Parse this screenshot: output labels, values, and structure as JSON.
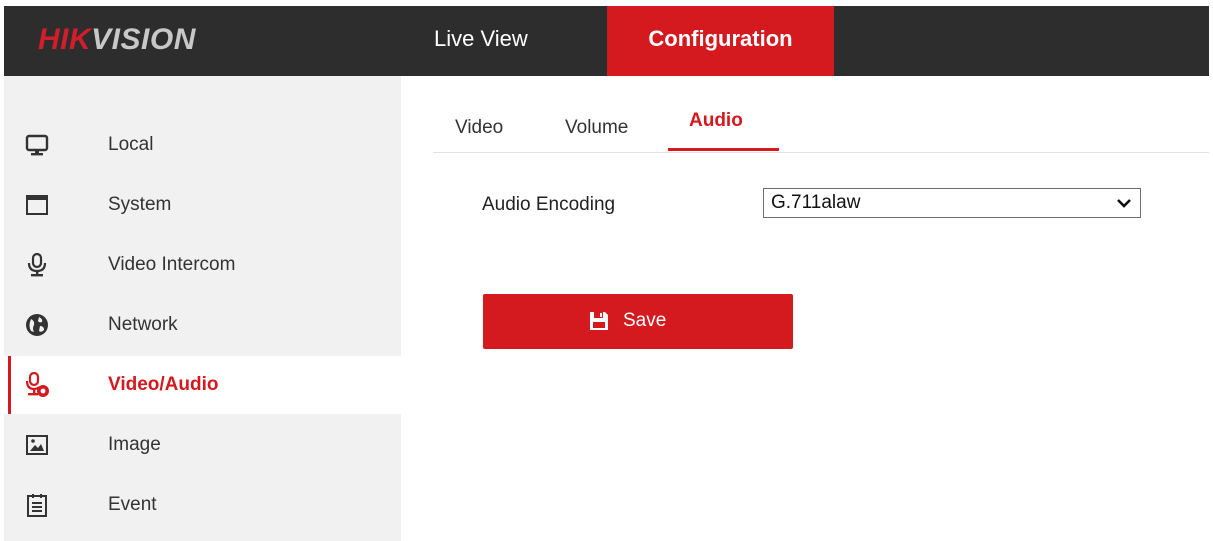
{
  "brand": {
    "prefix": "HIK",
    "suffix": "VISION"
  },
  "topnav": {
    "items": [
      {
        "label": "Live View",
        "active": false
      },
      {
        "label": "Configuration",
        "active": true
      }
    ]
  },
  "sidebar": {
    "items": [
      {
        "label": "Local",
        "icon": "monitor-icon",
        "active": false
      },
      {
        "label": "System",
        "icon": "window-icon",
        "active": false
      },
      {
        "label": "Video Intercom",
        "icon": "microphone-icon",
        "active": false
      },
      {
        "label": "Network",
        "icon": "globe-icon",
        "active": false
      },
      {
        "label": "Video/Audio",
        "icon": "microphone-camera-icon",
        "active": true
      },
      {
        "label": "Image",
        "icon": "image-icon",
        "active": false
      },
      {
        "label": "Event",
        "icon": "calendar-icon",
        "active": false
      }
    ]
  },
  "tabs": {
    "items": [
      {
        "label": "Video",
        "active": false
      },
      {
        "label": "Volume",
        "active": false
      },
      {
        "label": "Audio",
        "active": true
      }
    ]
  },
  "form": {
    "audio_encoding_label": "Audio Encoding",
    "audio_encoding_value": "G.711alaw"
  },
  "buttons": {
    "save_label": "Save"
  },
  "colors": {
    "accent": "#d4191f",
    "topbar": "#2d2d2d",
    "sidebar": "#f1f1f1"
  }
}
